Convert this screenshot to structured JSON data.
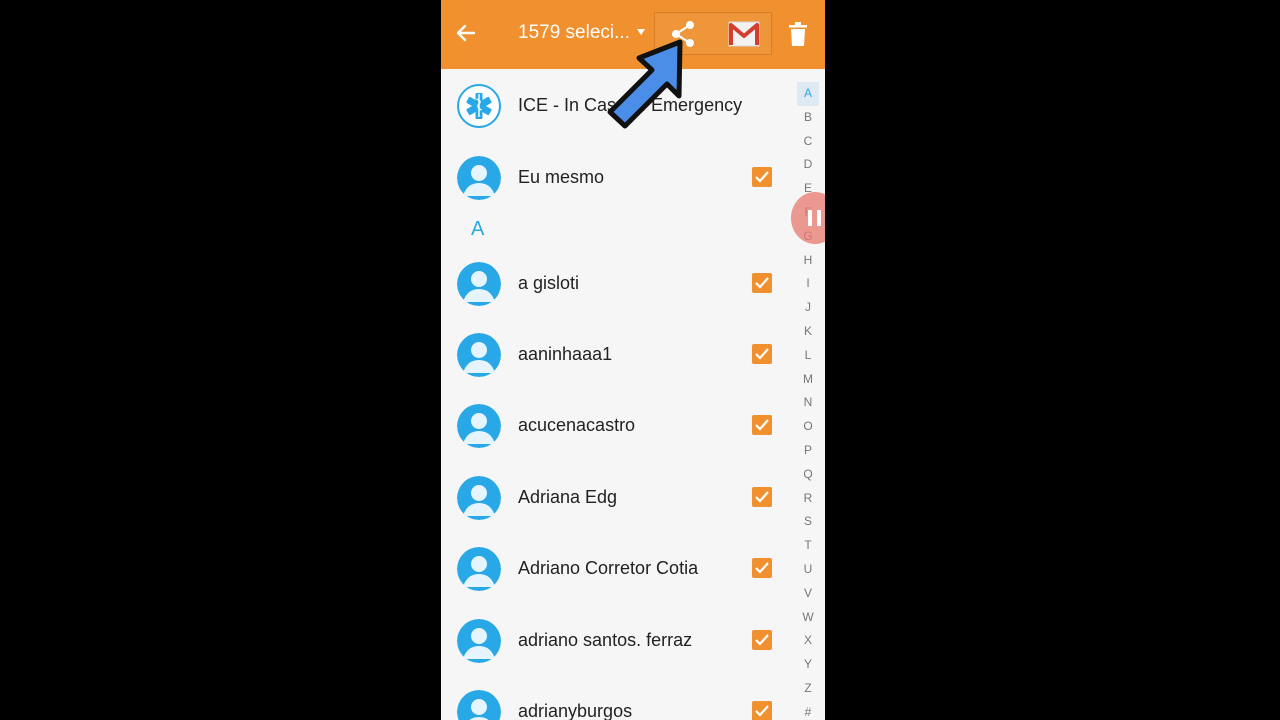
{
  "action_bar": {
    "selection_label": "1579 seleci...",
    "back_icon": "arrow-left-icon",
    "share_icon": "share-icon",
    "gmail_icon": "gmail-icon",
    "delete_icon": "trash-icon",
    "color": "#f0902e"
  },
  "contacts": {
    "ice": {
      "name": "ICE - In Case of Emergency"
    },
    "me": {
      "name": "Eu mesmo",
      "checked": true
    },
    "section_a": "A",
    "items": [
      {
        "name": "a gisloti",
        "checked": true
      },
      {
        "name": "aaninhaaa1",
        "checked": true
      },
      {
        "name": "acucenacastro",
        "checked": true
      },
      {
        "name": "Adriana Edg",
        "checked": true
      },
      {
        "name": "Adriano Corretor Cotia",
        "checked": true
      },
      {
        "name": "adriano santos. ferraz",
        "checked": true
      },
      {
        "name": "adrianyburgos",
        "checked": true
      }
    ]
  },
  "index_bar": {
    "letters": [
      "A",
      "B",
      "C",
      "D",
      "E",
      "F",
      "G",
      "H",
      "I",
      "J",
      "K",
      "L",
      "M",
      "N",
      "O",
      "P",
      "Q",
      "R",
      "S",
      "T",
      "U",
      "V",
      "W",
      "X",
      "Y",
      "Z",
      "#"
    ],
    "active": "A"
  },
  "colors": {
    "accent": "#f0902e",
    "avatar_blue": "#29a8e8",
    "section_blue": "#29a8e8"
  }
}
